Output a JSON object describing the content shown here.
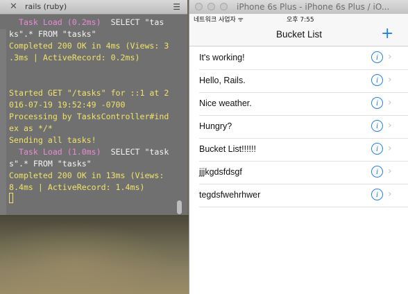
{
  "terminal": {
    "title": "rails (ruby)",
    "close_glyph": "✕",
    "menu_glyph": "☰",
    "lines": [
      {
        "text": "  Task Load (0.2ms)  SELECT \"tas",
        "color": "pink-white"
      },
      {
        "text": "ks\".* FROM \"tasks\"",
        "color": "white"
      },
      {
        "text": "Completed 200 OK in 4ms (Views: 3",
        "color": "yellow"
      },
      {
        "text": ".3ms | ActiveRecord: 0.2ms)",
        "color": "yellow"
      },
      {
        "text": "",
        "color": "yellow"
      },
      {
        "text": "",
        "color": "yellow"
      },
      {
        "text": "Started GET \"/tasks\" for ::1 at 2",
        "color": "yellow"
      },
      {
        "text": "016-07-19 19:52:49 -0700",
        "color": "yellow"
      },
      {
        "text": "Processing by TasksController#ind",
        "color": "yellow"
      },
      {
        "text": "ex as */*",
        "color": "yellow"
      },
      {
        "text": "Sending all tasks!",
        "color": "yellow"
      },
      {
        "text": "  Task Load (1.0ms)  SELECT \"task",
        "color": "pink-white"
      },
      {
        "text": "s\".* FROM \"tasks\"",
        "color": "white"
      },
      {
        "text": "Completed 200 OK in 13ms (Views:",
        "color": "yellow"
      },
      {
        "text": "8.4ms | ActiveRecord: 1.4ms)",
        "color": "yellow"
      }
    ],
    "colors": {
      "yellow": "#f2e26a",
      "pink": "#e88ad6",
      "white": "#f4f4f4"
    }
  },
  "simulator": {
    "window_title": "iPhone 6s Plus - iPhone 6s Plus / iO...",
    "status_carrier": "네트워크 사업자 ᯤ",
    "status_time": "오후 7:55",
    "nav_title": "Bucket List",
    "add_glyph": "+",
    "accent_color": "#1e7ef5",
    "info_glyph": "i",
    "chevron_glyph": "›",
    "items": [
      {
        "label": "It's working!"
      },
      {
        "label": "Hello, Rails."
      },
      {
        "label": "Nice weather."
      },
      {
        "label": "Hungry?"
      },
      {
        "label": "Bucket List!!!!!!"
      },
      {
        "label": "jjjkgdsfdsgf"
      },
      {
        "label": "tegdsfwehrhwer"
      }
    ]
  }
}
